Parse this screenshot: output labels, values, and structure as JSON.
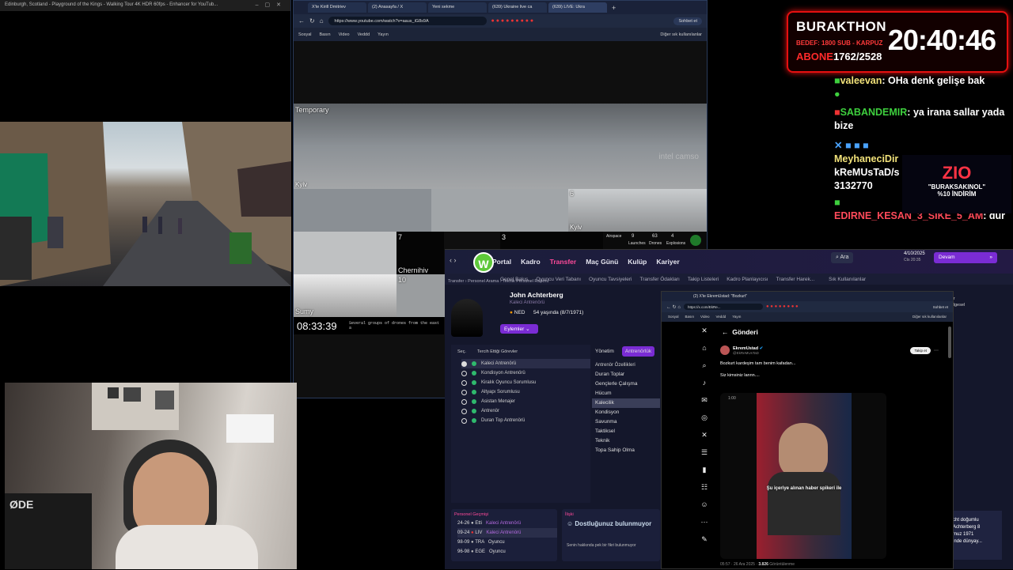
{
  "video_window": {
    "title": "Edinburgh, Scotland - Playground of the Kings - Walking Tour 4K HDR 60fps - Enhancer for YouTub..."
  },
  "browser": {
    "tabs": [
      "X'te Kirill Dmitriev",
      "(2) Anasayfa / X",
      "Yeni sekme",
      "(639) Ukraine live ca",
      "(639) LIVE: Ukra"
    ],
    "url": "https://www.youtube.com/watch?v=aaus_iG8s9A",
    "chat_btn": "Sohbet et",
    "bookmarks": [
      "Sosyal",
      "Basın",
      "Video",
      "Veddd",
      "Yayın"
    ],
    "bookmarks_other": "Diğer sık kullanılanlar",
    "cams": {
      "temporary": "Temporary",
      "kyiv1": "Kyiv",
      "kyiv2": "Kyiv",
      "chernihiv": "Chernihiv",
      "sumy": "Sumy",
      "clock": "08:33:39",
      "ticker": "Several groups of drones from the east a",
      "n6": "6",
      "n7": "7",
      "n3": "3",
      "n10": "10",
      "watermark": "intel camso"
    },
    "stats": {
      "airspace": "Airspace",
      "launches_v": "9",
      "launches": "Launches",
      "drones_v": "63",
      "drones": "Drones",
      "explosions_v": "4",
      "explosions": "Explosions"
    }
  },
  "subathon": {
    "title": "BURAKTHON",
    "line2": "BEDEF: 1800 SUB - KARPUZ",
    "abone_label": "ABONE",
    "abone_value": "1762/2528",
    "timer": "20:40:46"
  },
  "chat": [
    {
      "user": "valeevan",
      "msg": "OHa denk gelişe bak"
    },
    {
      "user": "SABANDEMIR",
      "msg": "ya irana sallar yada bize"
    },
    {
      "user": "MeyhaneciDir",
      "msg": ""
    },
    {
      "user": "kReMUsTaD/s",
      "msg": "3132770"
    },
    {
      "user": "EDIRNE_KESAN_3_SIKE_5_AM",
      "msg": "dur"
    }
  ],
  "promo": {
    "brand": "ZIO",
    "code": "\"BURAKSAKINOL\"",
    "discount": "%10 İNDİRİM"
  },
  "fm": {
    "nav": [
      "Portal",
      "Kadro",
      "Transfer",
      "Maç Günü",
      "Kulüp",
      "Kariyer"
    ],
    "sub": [
      "Genel Bakış",
      "Oyuncu Veri Tabanı",
      "Oyuncu Tavsiyeleri",
      "Transfer Ödakları",
      "Takip Listeleri",
      "Kadro Planlayıcısı",
      "Transfer Harek..."
    ],
    "search": "Ara",
    "date": "4/10/2025",
    "date_sub": "Cts 20:35",
    "continue": "Devam",
    "fav": "Sık Kullanılanlar",
    "breadcrumb": "Transfer  ›  Personel Arama  ›  Teknik Personel Raporu",
    "person": {
      "name": "John Achterberg",
      "role": "Kaleci Antrenörü",
      "nation": "NED",
      "age": "54 yaşında (8/7/1971)",
      "actions": "Eylemler"
    },
    "roles_header": [
      "Seç.",
      "Tercih Ettiği Görevler"
    ],
    "roles": [
      "Kaleci Antrenörü",
      "Kondisyon Antrenörü",
      "Kiralık Oyuncu Sorumlusu",
      "Altyapı Sorumlusu",
      "Asistan Menajer",
      "Antrenör",
      "Duran Top Antrenörü"
    ],
    "right_tabs": [
      "Yönetim",
      "Antrenörlük"
    ],
    "attr_title": "Antrenör Özellikleri",
    "attrs": [
      "Duran Toplar",
      "Gençlerle Çalışma",
      "Hücum",
      "Kalecilik",
      "Kondisyon",
      "Savunma",
      "Taktiksel",
      "Teknik",
      "Topa Sahip Olma"
    ],
    "history_title": "Personel Geçmişi",
    "history": [
      {
        "yr": "24-26",
        "club": "Etti",
        "role": "Kaleci Antrenörü"
      },
      {
        "yr": "09-24",
        "club": "LIV",
        "role": "Kaleci Antrenörü"
      },
      {
        "yr": "98-09",
        "club": "TRA",
        "role": "Oyuncu"
      },
      {
        "yr": "96-98",
        "club": "EGE",
        "role": "Oyuncu"
      }
    ],
    "relation_title": "İlişki",
    "relation": "Dostluğunuz bulunmuyor",
    "relation_sub": "Senin hakkında pek bir fikri bulunmuyor",
    "right_snips": [
      "cht doğumlu",
      "Achterberg 8",
      "muz 1971",
      "inde dünyay..."
    ],
    "right_top": [
      "ildir",
      "Bölgesel"
    ]
  },
  "x_window": {
    "tab": "(2) X'te EkremUstad: \"Bozkurt\"",
    "url": "https://x.com/EkRe...",
    "chat_btn": "Sohbet et",
    "bookmarks": [
      "Sosyal",
      "Basın",
      "Video",
      "Veddd",
      "Yayın"
    ],
    "bookmarks_other": "Diğer sık kullanılanlar",
    "header": "Gönderi",
    "author": "EkremUstad",
    "handle": "@EkReMUsTaD",
    "follow": "Takip et",
    "text1": "Bozkurt kardeşim tam benim kafadan...",
    "text2": "Siz kimsiniz lannn....",
    "video_time": "1:00",
    "caption": "Şu içeriye alınan haber spikeri ile",
    "footer_time": "05:57 · 26 Ara 2025",
    "views_v": "3.826",
    "views": "Görüntülenme"
  },
  "webcam": {
    "mic_brand": "ØDE"
  }
}
